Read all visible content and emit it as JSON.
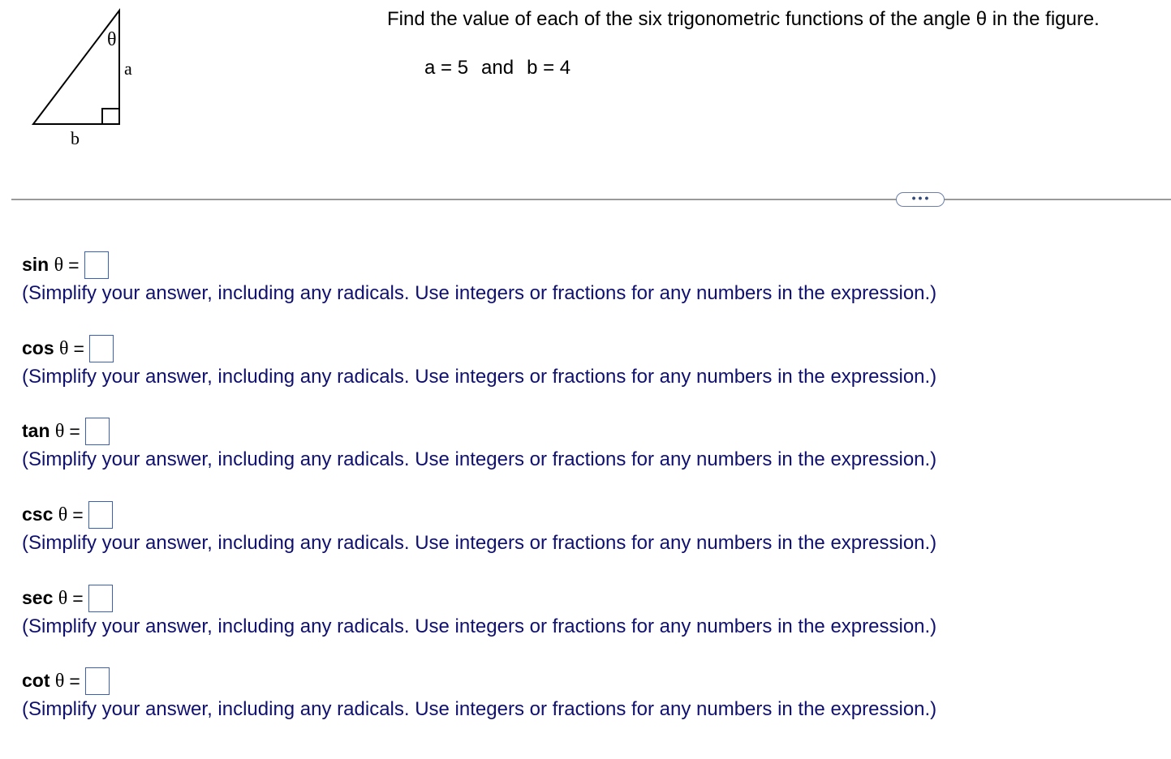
{
  "figure": {
    "theta_symbol": "θ",
    "side_a_label": "a",
    "side_b_label": "b"
  },
  "question": {
    "text": "Find the value of each of the six trigonometric functions of the angle θ in the figure.",
    "given_a": "a = 5",
    "given_and": "and",
    "given_b": "b = 4"
  },
  "more_button": {
    "icon": "ellipsis-icon",
    "glyph": "•••"
  },
  "items": [
    {
      "label": "sin",
      "theta": "θ",
      "eq": "=",
      "value": "",
      "hint": "(Simplify your answer, including any radicals. Use integers or fractions for any numbers in the expression.)"
    },
    {
      "label": "cos",
      "theta": "θ",
      "eq": "=",
      "value": "",
      "hint": "(Simplify your answer, including any radicals. Use integers or fractions for any numbers in the expression.)"
    },
    {
      "label": "tan",
      "theta": "θ",
      "eq": "=",
      "value": "",
      "hint": "(Simplify your answer, including any radicals. Use integers or fractions for any numbers in the expression.)"
    },
    {
      "label": "csc",
      "theta": "θ",
      "eq": "=",
      "value": "",
      "hint": "(Simplify your answer, including any radicals. Use integers or fractions for any numbers in the expression.)"
    },
    {
      "label": "sec",
      "theta": "θ",
      "eq": "=",
      "value": "",
      "hint": "(Simplify your answer, including any radicals. Use integers or fractions for any numbers in the expression.)"
    },
    {
      "label": "cot",
      "theta": "θ",
      "eq": "=",
      "value": "",
      "hint": "(Simplify your answer, including any radicals. Use integers or fractions for any numbers in the expression.)"
    }
  ],
  "colors": {
    "hint_text": "#101070",
    "box_border": "#3a5fb5",
    "divider": "#9a9a9a"
  }
}
